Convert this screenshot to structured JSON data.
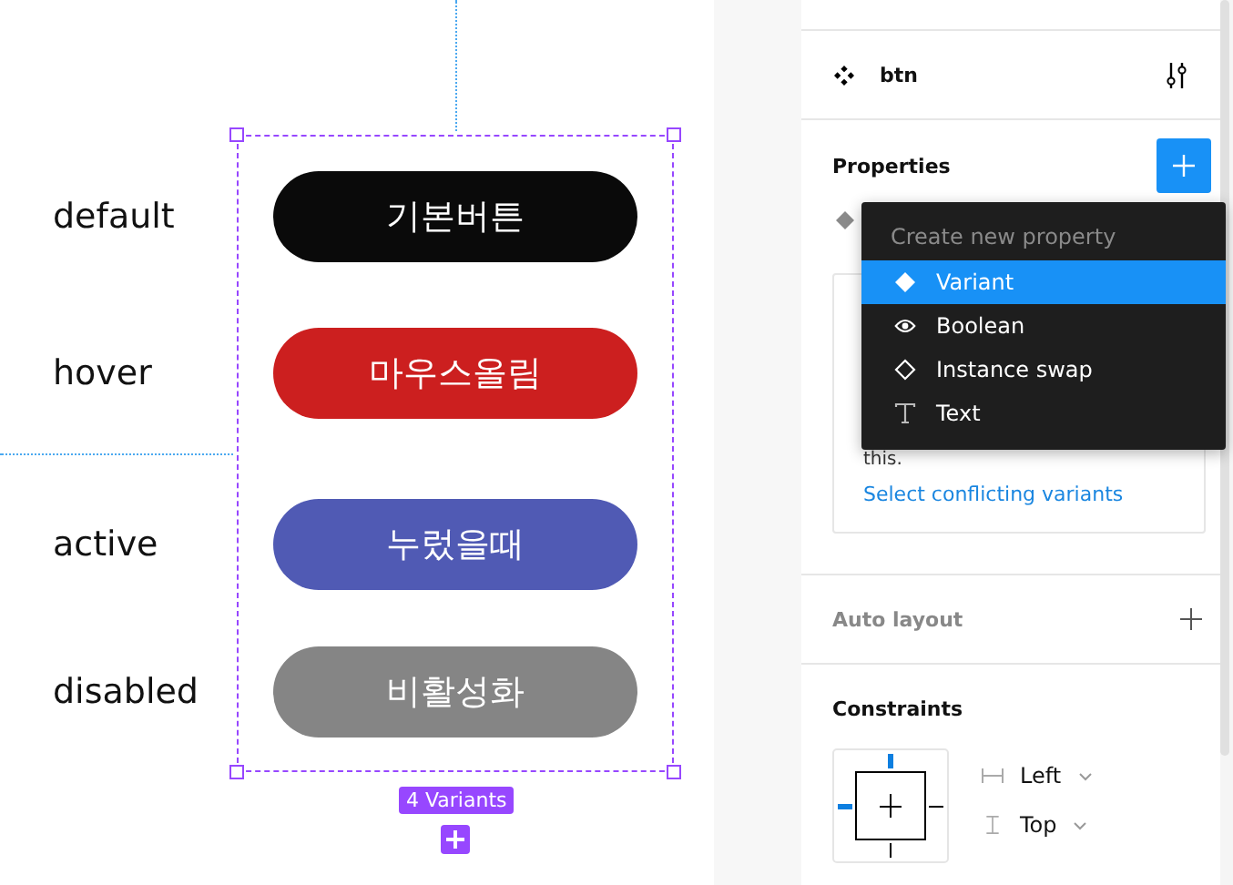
{
  "canvas": {
    "variants": [
      {
        "label": "default",
        "text": "기본버튼",
        "color": "#0a0a0a"
      },
      {
        "label": "hover",
        "text": "마우스올림",
        "color": "#cc1f1f"
      },
      {
        "label": "active",
        "text": "누렀을때",
        "color": "#505ab4"
      },
      {
        "label": "disabled",
        "text": "비활성화",
        "color": "#858585"
      }
    ],
    "badge": "4 Variants"
  },
  "panel": {
    "component": {
      "name": "btn"
    },
    "properties": {
      "title": "Properties",
      "conflict_text": "this.",
      "link": "Select conflicting variants"
    },
    "menu": {
      "heading": "Create new property",
      "items": [
        {
          "kind": "variant",
          "label": "Variant",
          "selected": true
        },
        {
          "kind": "boolean",
          "label": "Boolean",
          "selected": false
        },
        {
          "kind": "instance",
          "label": "Instance swap",
          "selected": false
        },
        {
          "kind": "text",
          "label": "Text",
          "selected": false
        }
      ]
    },
    "auto_layout": {
      "title": "Auto layout"
    },
    "constraints": {
      "title": "Constraints",
      "horizontal": "Left",
      "vertical": "Top"
    }
  }
}
